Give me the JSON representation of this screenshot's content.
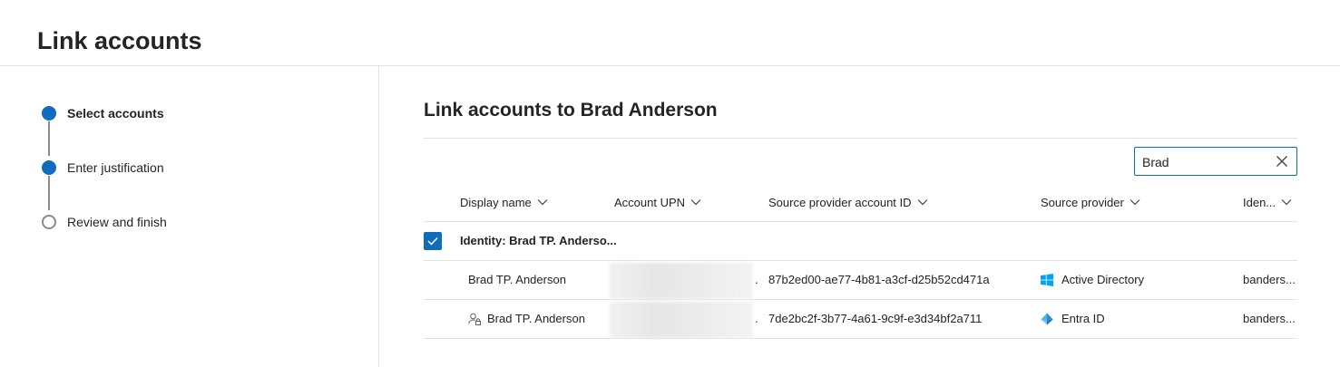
{
  "page": {
    "title": "Link accounts"
  },
  "steps": [
    {
      "label": "Select accounts",
      "state": "current"
    },
    {
      "label": "Enter justification",
      "state": "completed"
    },
    {
      "label": "Review and finish",
      "state": "pending"
    }
  ],
  "main": {
    "title": "Link accounts to Brad Anderson",
    "search": {
      "value": "Brad"
    },
    "columns": [
      {
        "label": "Display name"
      },
      {
        "label": "Account UPN"
      },
      {
        "label": "Source provider account ID"
      },
      {
        "label": "Source provider"
      },
      {
        "label": "Iden..."
      }
    ],
    "group": {
      "label": "Identity: Brad TP. Anderso...",
      "checked": true
    },
    "rows": [
      {
        "display_name": "Brad TP. Anderson",
        "upn": ".",
        "account_id": "87b2ed00-ae77-4b81-a3cf-d25b52cd471a",
        "provider": "Active Directory",
        "provider_icon": "windows-icon",
        "identity": "banders..."
      },
      {
        "display_name": "Brad TP. Anderson",
        "display_icon": "user-lock-icon",
        "upn": ".",
        "account_id": "7de2bc2f-3b77-4a61-9c9f-e3d34bf2a711",
        "provider": "Entra ID",
        "provider_icon": "entra-id-icon",
        "identity": "banders..."
      }
    ]
  },
  "colors": {
    "accent": "#0f6cbd",
    "divider": "#e1e1e1",
    "text": "#242424"
  }
}
